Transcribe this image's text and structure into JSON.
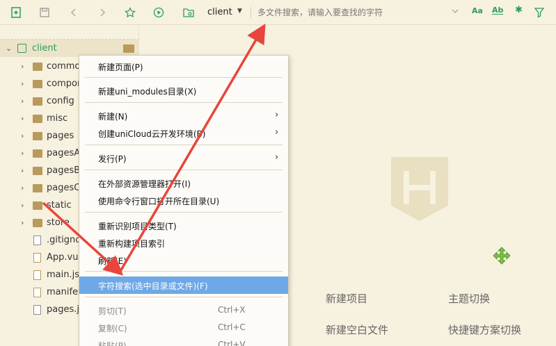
{
  "toolbar": {
    "project_name": "client",
    "search_placeholder": "多文件搜索，请输入要查找的字符",
    "opt_case": "Aa",
    "opt_word": "Ab"
  },
  "sidebar": {
    "items": [
      {
        "label": "client"
      },
      {
        "label": "commo"
      },
      {
        "label": "compor"
      },
      {
        "label": "config"
      },
      {
        "label": "misc"
      },
      {
        "label": "pages"
      },
      {
        "label": "pagesA"
      },
      {
        "label": "pagesB"
      },
      {
        "label": "pagesC"
      },
      {
        "label": "static"
      },
      {
        "label": "store"
      },
      {
        "label": ".gitigno"
      },
      {
        "label": "App.vue"
      },
      {
        "label": "main.js"
      },
      {
        "label": "manifes"
      },
      {
        "label": "pages.js"
      }
    ]
  },
  "context_menu": {
    "new_page": "新建页面(P)",
    "new_uni_modules": "新建uni_modules目录(X)",
    "new": "新建(N)",
    "create_unicloud": "创建uniCloud云开发环境(B)",
    "publish": "发行(P)",
    "open_in_explorer": "在外部资源管理器打开(I)",
    "open_in_terminal": "使用命令行窗口打开所在目录(U)",
    "reidentify_type": "重新识别项目类型(T)",
    "rebuild_index": "重新构建项目索引",
    "refresh": "刷新(E)",
    "char_search": "字符搜索(选中目录或文件)(F)",
    "cut": "剪切(T)",
    "cut_key": "Ctrl+X",
    "copy": "复制(C)",
    "copy_key": "Ctrl+C",
    "paste": "粘贴(P)",
    "paste_key": "Ctrl+V"
  },
  "welcome": {
    "new_project": "新建项目",
    "theme_switch": "主题切换",
    "new_blank_file": "新建空白文件",
    "shortcut_switch": "快捷键方案切换"
  },
  "colors": {
    "background": "#f7f1df",
    "highlight": "#6ea8e6",
    "arrow": "#e8453c",
    "accent_green": "#2a9d5c"
  }
}
